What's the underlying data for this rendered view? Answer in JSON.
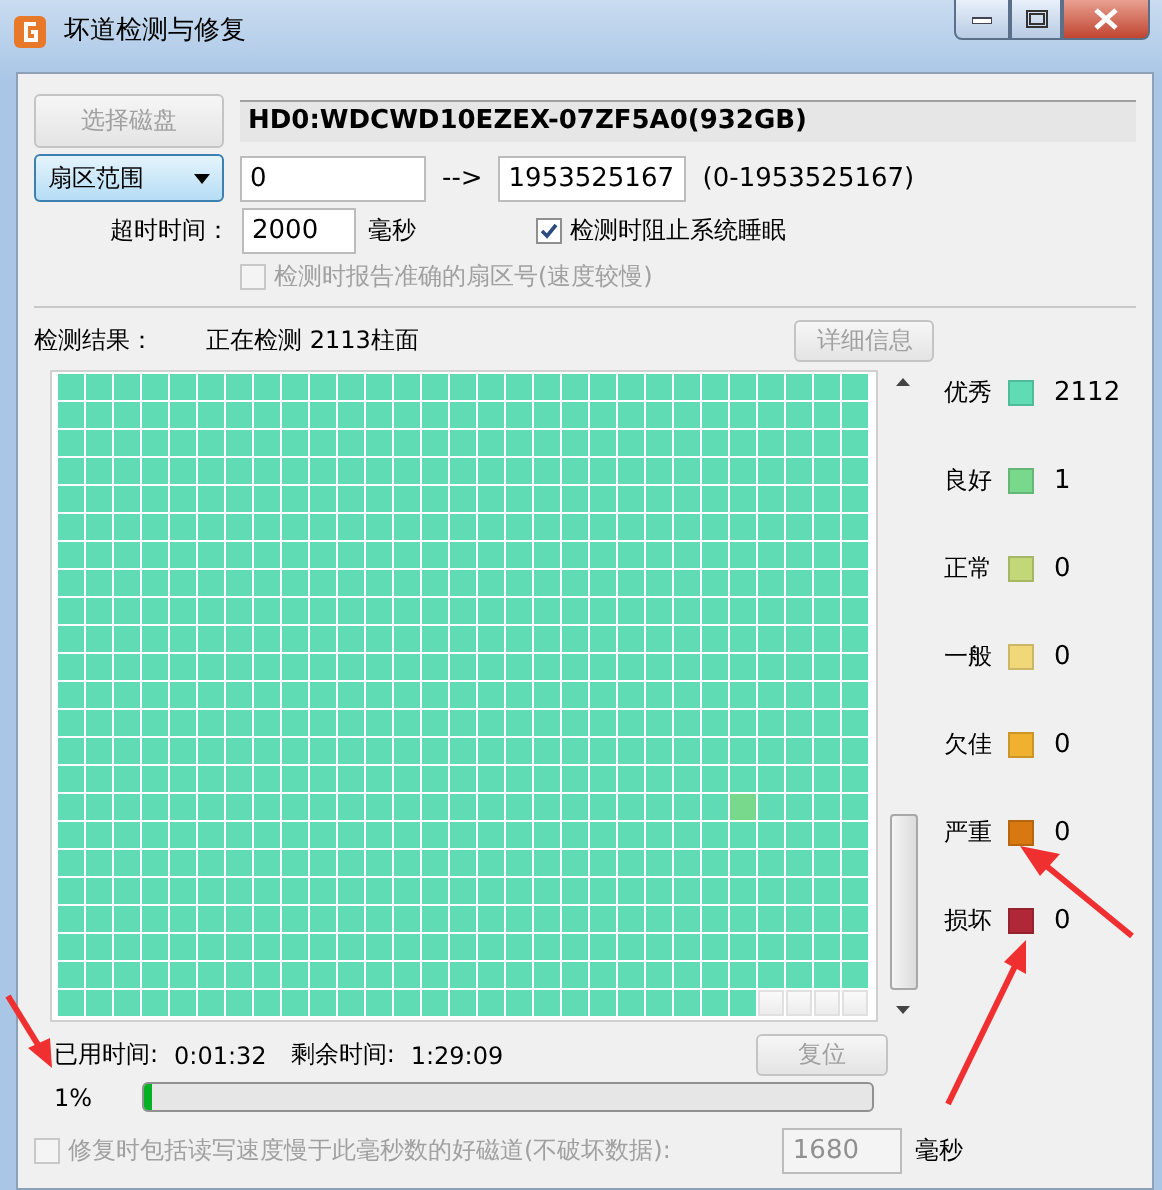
{
  "window": {
    "title": "坏道检测与修复"
  },
  "disk_button": {
    "label": "选择磁盘",
    "disabled": true
  },
  "disk_name": "HD0:WDCWD10EZEX-07ZF5A0(932GB)",
  "range_dropdown": {
    "label": "扇区范围"
  },
  "range_start": "0",
  "range_arrow": "-->",
  "range_end": "1953525167",
  "range_hint": "(0-1953525167)",
  "timeout": {
    "label": "超时时间：",
    "value": "2000",
    "unit": "毫秒"
  },
  "prevent_sleep": {
    "label": "检测时阻止系统睡眠",
    "checked": true,
    "disabled": false
  },
  "report_exact": {
    "label": "检测时报告准确的扇区号(速度较慢)",
    "checked": false,
    "disabled": true
  },
  "results": {
    "label": "检测结果：",
    "status": "正在检测 2113柱面",
    "details_button": {
      "label": "详细信息",
      "disabled": true
    }
  },
  "legend": [
    {
      "label": "优秀",
      "color": "#5fdcb4",
      "count": "2112"
    },
    {
      "label": "良好",
      "color": "#78d88c",
      "count": "1"
    },
    {
      "label": "正常",
      "color": "#c2d878",
      "count": "0"
    },
    {
      "label": "一般",
      "color": "#f0d878",
      "count": "0"
    },
    {
      "label": "欠佳",
      "color": "#f0b030",
      "count": "0"
    },
    {
      "label": "严重",
      "color": "#d87810",
      "count": "0"
    },
    {
      "label": "损坏",
      "color": "#b02838",
      "count": "0"
    }
  ],
  "elapsed": {
    "label": "已用时间:",
    "value": "0:01:32"
  },
  "remaining": {
    "label": "剩余时间:",
    "value": "1:29:09"
  },
  "reset_button": {
    "label": "复位",
    "disabled": true
  },
  "progress": {
    "reading": "1%",
    "level": 0.01
  },
  "slow_repair": {
    "label": "修复时包括读写速度慢于此毫秒数的好磁道(不破坏数据):",
    "checked": false,
    "disabled": true,
    "value": "1680",
    "unit": "毫秒"
  }
}
